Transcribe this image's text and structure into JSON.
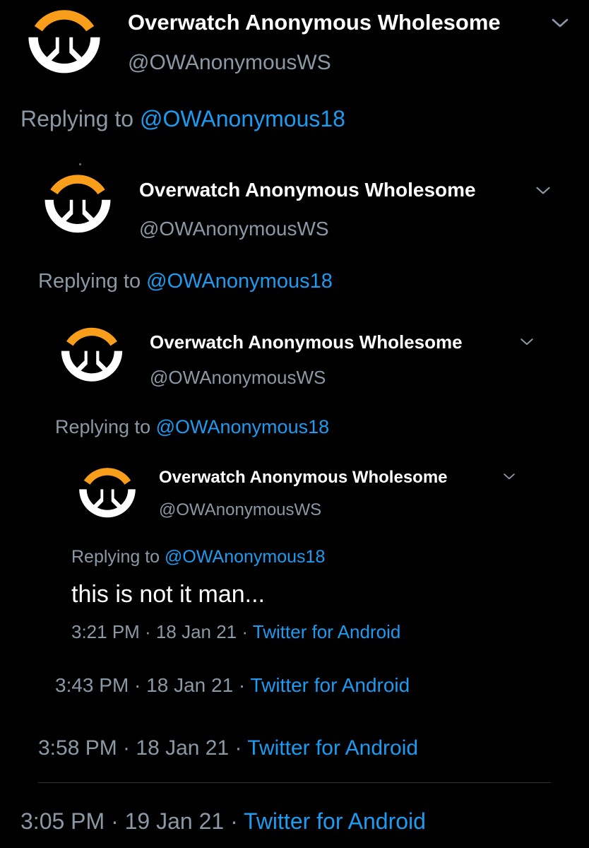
{
  "colors": {
    "background": "#000000",
    "name": "#ffffff",
    "secondary": "#8b98a5",
    "link": "#1d9bf0",
    "logo_orange": "#f99e1a",
    "logo_white": "#ffffff"
  },
  "tweets": [
    {
      "author_name": "Overwatch Anonymous Wholesome",
      "author_handle": "@OWAnonymousWS",
      "avatar_icon": "overwatch-logo-icon",
      "menu_icon": "chevron-down-icon",
      "replying_prefix": "Replying to",
      "replying_to": "@OWAnonymous18",
      "timestamp": "3:05 PM · 19 Jan 21 ·",
      "source": "Twitter for Android"
    },
    {
      "author_name": "Overwatch Anonymous Wholesome",
      "author_handle": "@OWAnonymousWS",
      "avatar_icon": "overwatch-logo-icon",
      "menu_icon": "chevron-down-icon",
      "replying_prefix": "Replying to",
      "replying_to": "@OWAnonymous18",
      "timestamp": "3:58 PM · 18 Jan 21 ·",
      "source": "Twitter for Android"
    },
    {
      "author_name": "Overwatch Anonymous Wholesome",
      "author_handle": "@OWAnonymousWS",
      "avatar_icon": "overwatch-logo-icon",
      "menu_icon": "chevron-down-icon",
      "replying_prefix": "Replying to",
      "replying_to": "@OWAnonymous18",
      "timestamp": "3:43 PM · 18 Jan 21 ·",
      "source": "Twitter for Android"
    },
    {
      "author_name": "Overwatch Anonymous Wholesome",
      "author_handle": "@OWAnonymousWS",
      "avatar_icon": "overwatch-logo-icon",
      "menu_icon": "chevron-down-icon",
      "replying_prefix": "Replying to",
      "replying_to": "@OWAnonymous18",
      "text": "this is not it man...",
      "timestamp": "3:21 PM · 18 Jan 21 ·",
      "source": "Twitter for Android"
    }
  ]
}
